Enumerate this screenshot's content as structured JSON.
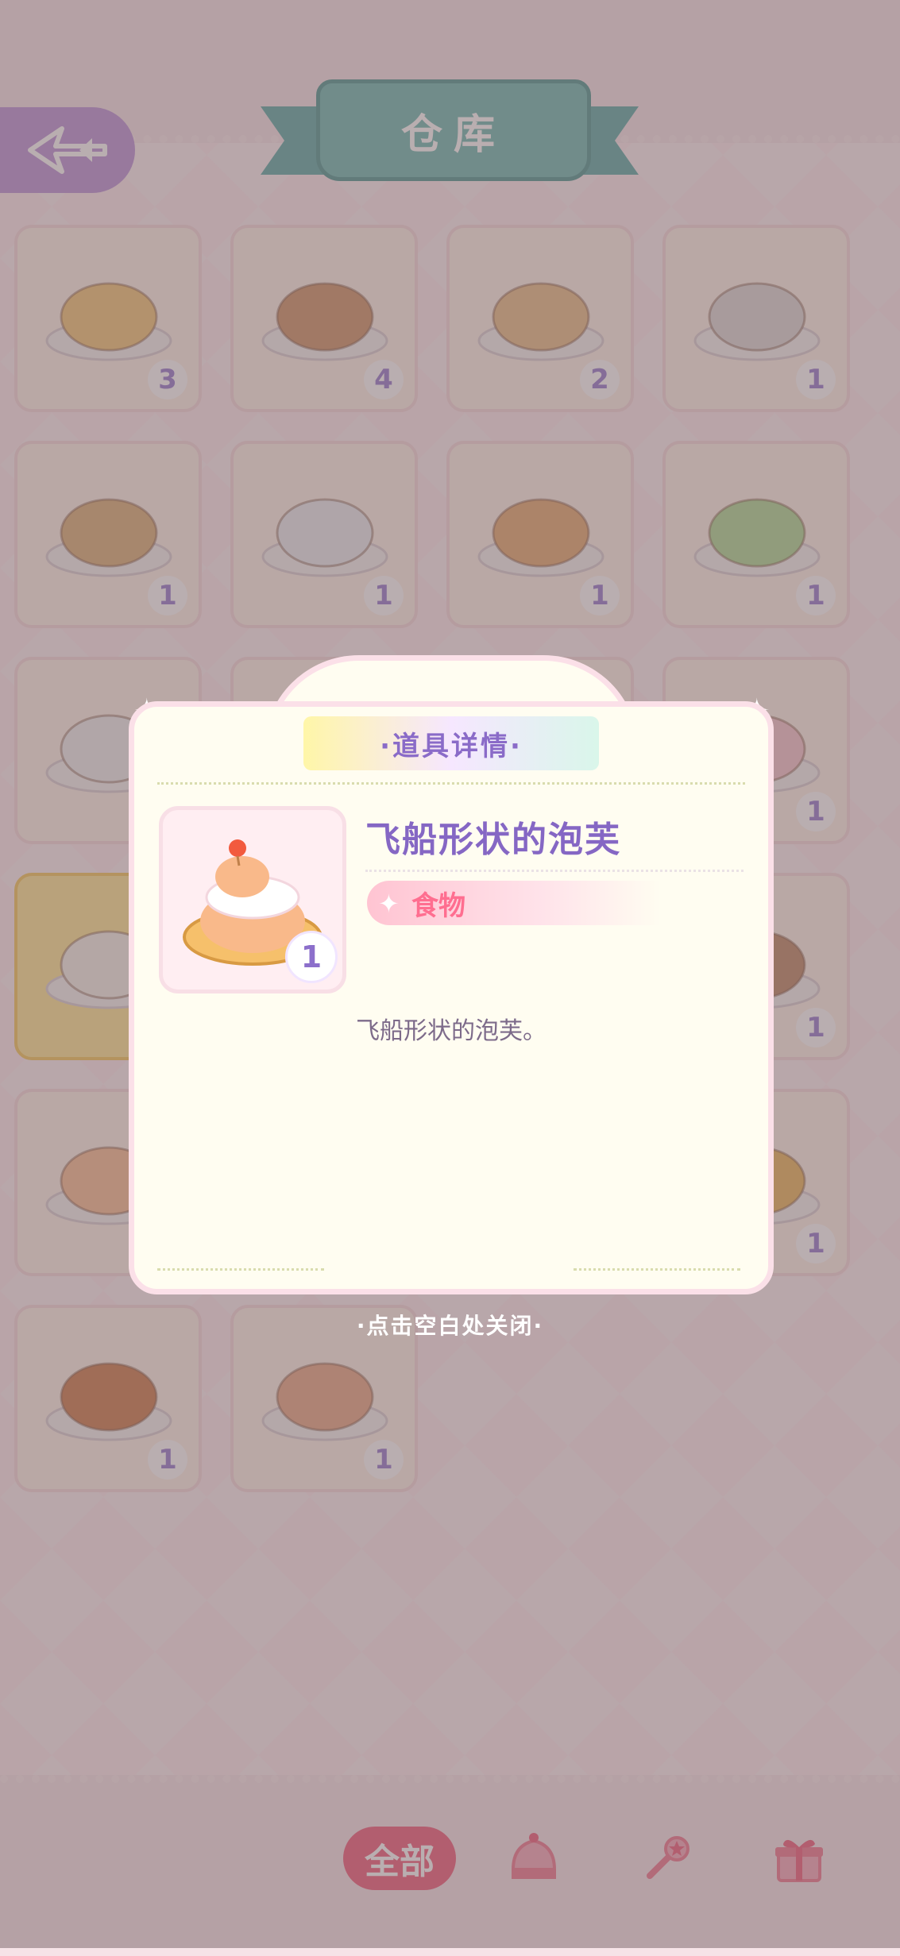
{
  "header": {
    "title": "仓库"
  },
  "inventory": [
    {
      "name": "roast-potatoes",
      "qty": "3"
    },
    {
      "name": "caramel-cake",
      "qty": "4"
    },
    {
      "name": "waffle-sandwich",
      "qty": "2"
    },
    {
      "name": "meat-skewer",
      "qty": "1"
    },
    {
      "name": "grilled-fish",
      "qty": "1"
    },
    {
      "name": "yogurt-jar",
      "qty": "1"
    },
    {
      "name": "bread-loaf",
      "qty": "1"
    },
    {
      "name": "salad-plate",
      "qty": "1"
    },
    {
      "name": "dumpling-bowl",
      "qty": ""
    },
    {
      "name": "hidden-item-a",
      "qty": ""
    },
    {
      "name": "hidden-item-b",
      "qty": ""
    },
    {
      "name": "ticket",
      "qty": "1"
    },
    {
      "name": "rice-ball",
      "qty": ""
    },
    {
      "name": "hidden-item-c",
      "qty": ""
    },
    {
      "name": "hidden-item-d",
      "qty": ""
    },
    {
      "name": "iced-drink",
      "qty": "1"
    },
    {
      "name": "cream-puff",
      "qty": ""
    },
    {
      "name": "hidden-item-e",
      "qty": ""
    },
    {
      "name": "hidden-item-f",
      "qty": ""
    },
    {
      "name": "roast-chicken",
      "qty": "1"
    },
    {
      "name": "hot-dog",
      "qty": "1"
    },
    {
      "name": "cake-slice",
      "qty": "1"
    }
  ],
  "modal": {
    "heading": "·道具详情·",
    "item_name": "飞船形状的泡芙",
    "item_qty": "1",
    "category": "食物",
    "description": "飞船形状的泡芙。",
    "close_hint": "·点击空白处关闭·"
  },
  "tabs": {
    "all_label": "全部"
  },
  "colors": {
    "accent_pink": "#f04f6f",
    "title_teal": "#5fb3ac",
    "back_purple": "#b58bd6",
    "modal_text_purple": "#8567c4"
  }
}
